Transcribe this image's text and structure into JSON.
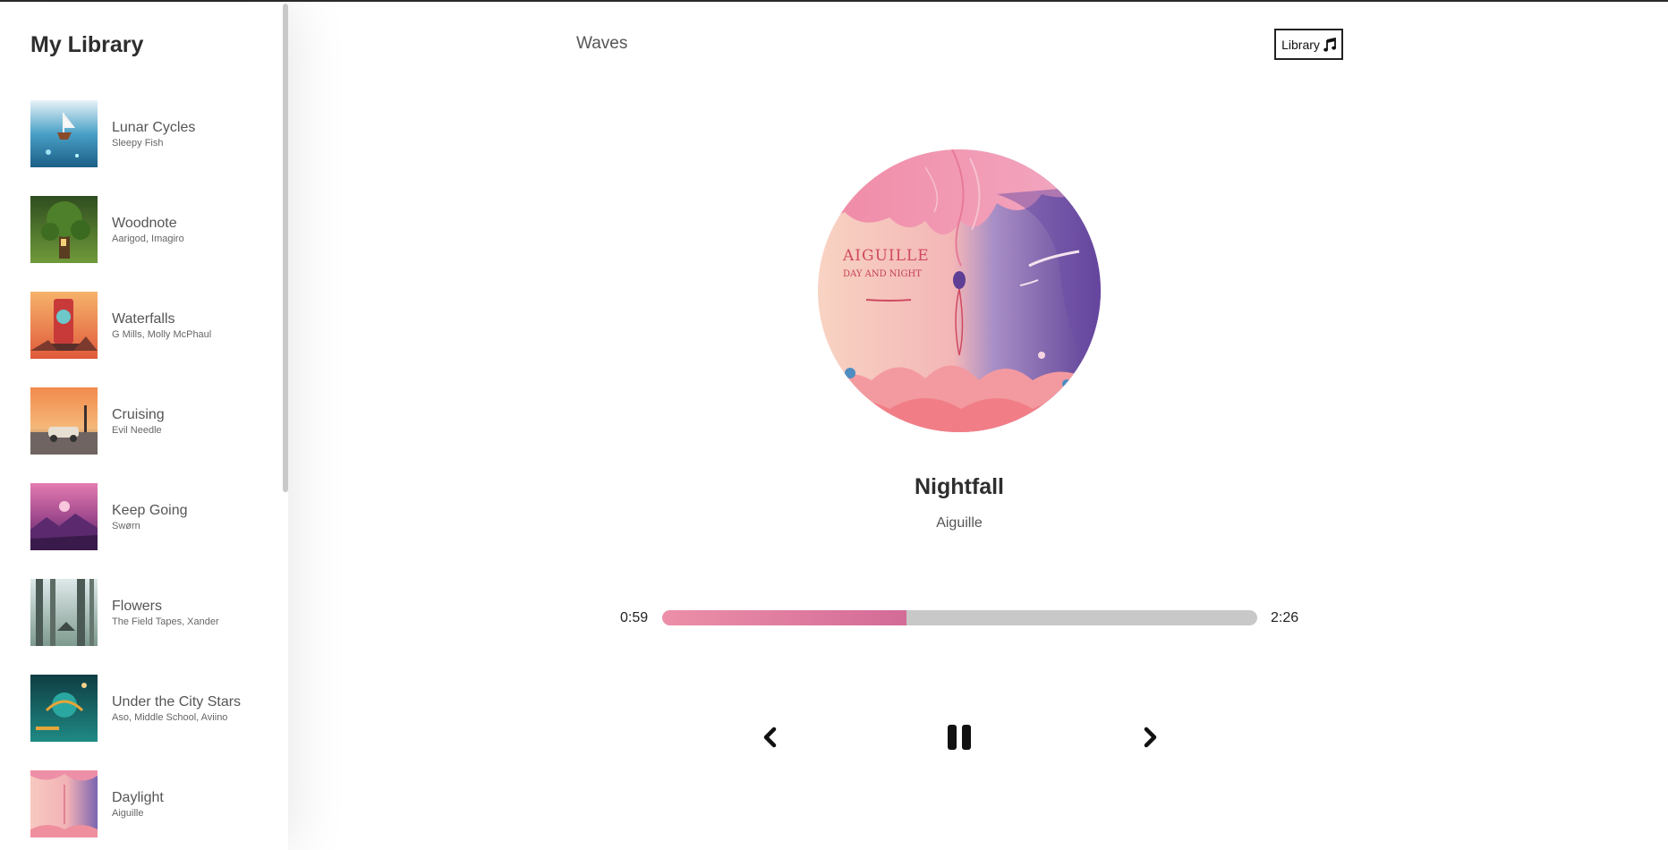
{
  "sidebar": {
    "title": "My Library",
    "items": [
      {
        "name": "Lunar Cycles",
        "artist": "Sleepy Fish"
      },
      {
        "name": "Woodnote",
        "artist": "Aarigod, Imagiro"
      },
      {
        "name": "Waterfalls",
        "artist": "G Mills, Molly McPhaul"
      },
      {
        "name": "Cruising",
        "artist": "Evil Needle"
      },
      {
        "name": "Keep Going",
        "artist": "Swørn"
      },
      {
        "name": "Flowers",
        "artist": "The Field Tapes, Xander"
      },
      {
        "name": "Under the City Stars",
        "artist": "Aso, Middle School, Aviino"
      },
      {
        "name": "Daylight",
        "artist": "Aiguille"
      }
    ]
  },
  "header": {
    "brand": "Waves",
    "library_button_label": "Library",
    "library_button_icon": "music-note-icon"
  },
  "now_playing": {
    "title": "Nightfall",
    "artist": "Aiguille",
    "album_art_text": [
      "AIGUILLE",
      "DAY AND NIGHT"
    ],
    "current_time": "0:59",
    "total_time": "2:26",
    "progress_fraction": 0.41
  },
  "controls": {
    "prev_icon": "chevron-left-icon",
    "pause_icon": "pause-icon",
    "next_icon": "chevron-right-icon"
  },
  "colors": {
    "progress_fill_start": "#ec8fa8",
    "progress_fill_end": "#d36b97",
    "progress_track": "#c8c8c8"
  }
}
